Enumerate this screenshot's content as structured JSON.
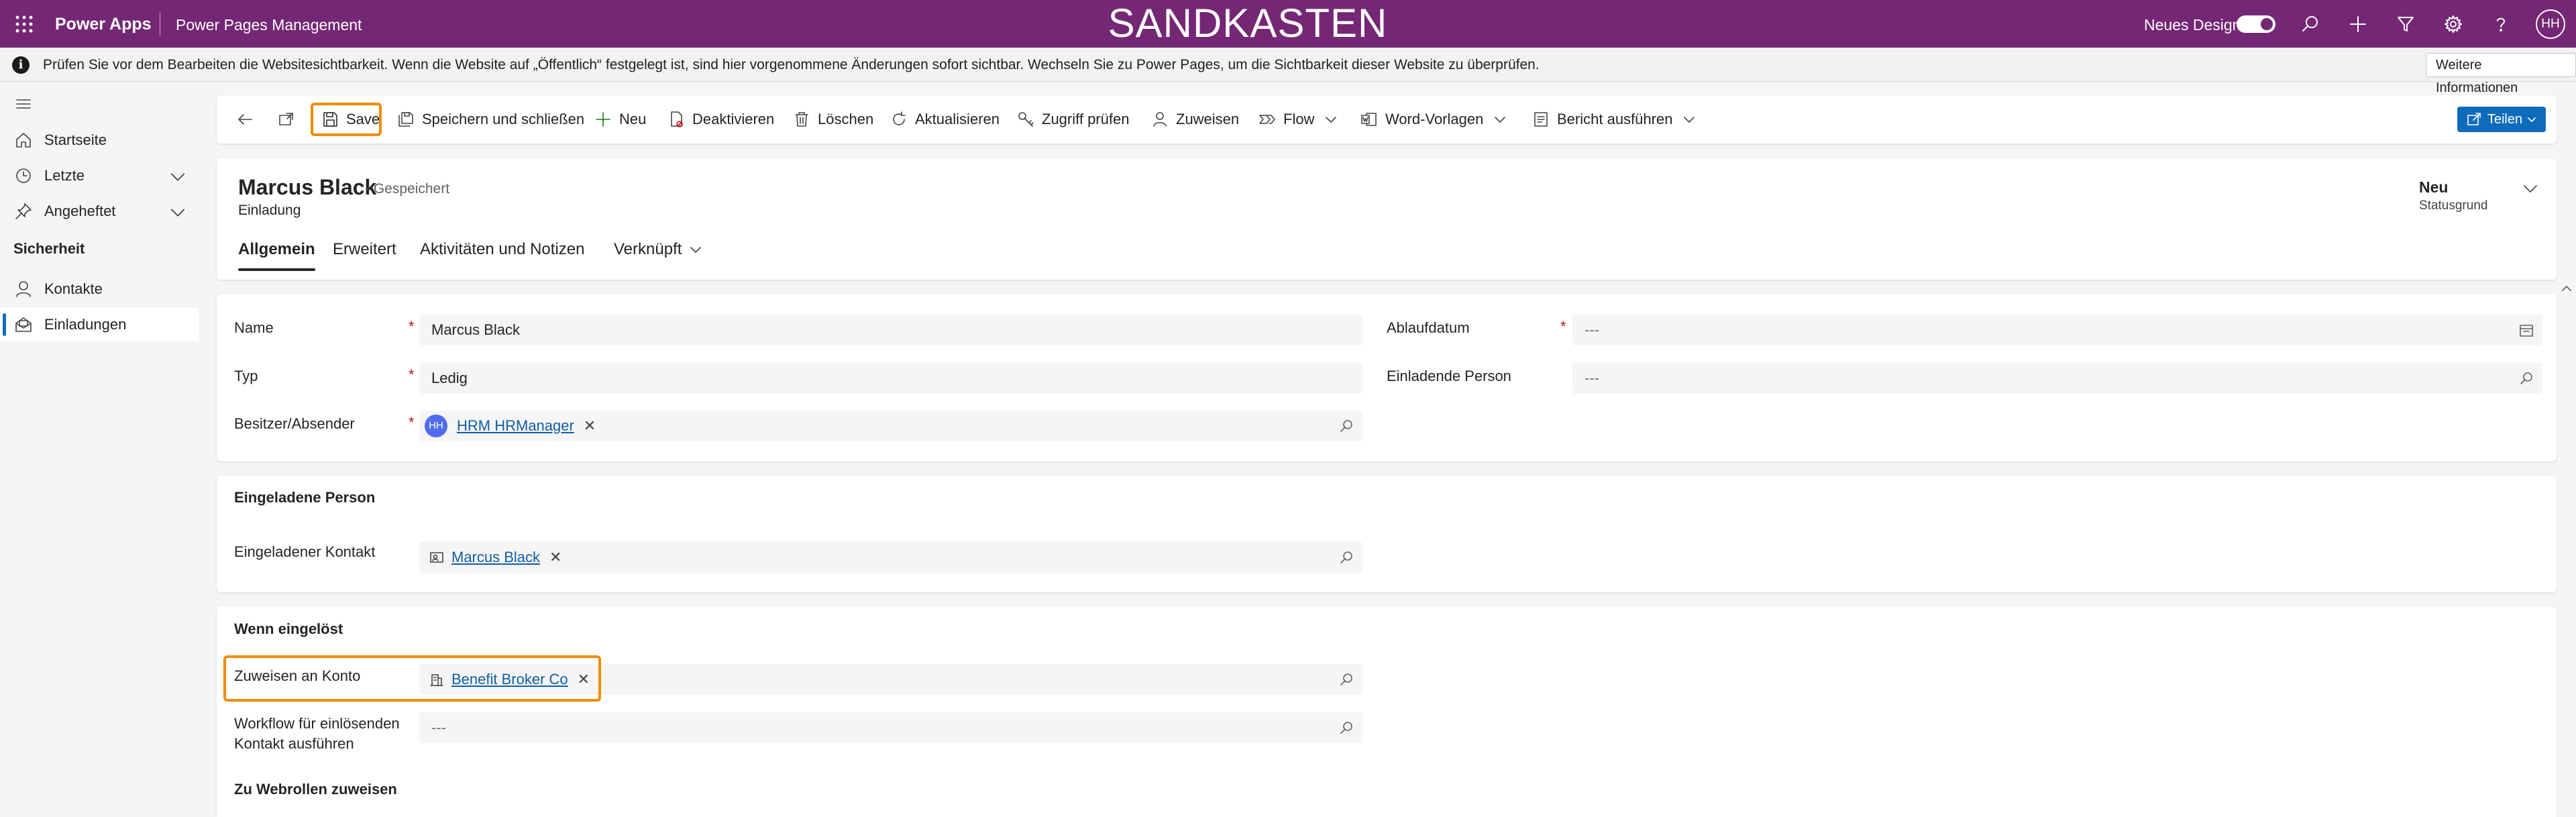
{
  "topbar": {
    "app_name": "Power Apps",
    "module_name": "Power Pages Management",
    "environment_banner": "SANDKASTEN",
    "new_design_label": "Neues Design",
    "avatar_initials": "HH",
    "background_color": "#742774"
  },
  "infobar": {
    "message": "Prüfen Sie vor dem Bearbeiten die Websitesichtbarkeit. Wenn die Website auf „Öffentlich“ festgelegt ist, sind hier vorgenommene Änderungen sofort sichtbar. Wechseln Sie zu Power Pages, um die Sichtbarkeit dieser Website zu überprüfen.",
    "more_button": "Weitere Informationen"
  },
  "sidebar": {
    "items": [
      {
        "label": "Startseite",
        "icon": "home-icon"
      },
      {
        "label": "Letzte",
        "icon": "clock-icon"
      },
      {
        "label": "Angeheftet",
        "icon": "pin-icon"
      }
    ],
    "section_title": "Sicherheit",
    "section_items": [
      {
        "label": "Kontakte",
        "icon": "person-icon"
      },
      {
        "label": "Einladungen",
        "icon": "mail-open-icon"
      }
    ]
  },
  "commandbar": {
    "save": "Save",
    "save_and_close": "Speichern und schließen",
    "new": "Neu",
    "deactivate": "Deaktivieren",
    "delete": "Löschen",
    "refresh": "Aktualisieren",
    "check_access": "Zugriff prüfen",
    "assign": "Zuweisen",
    "flow": "Flow",
    "word_templates": "Word-Vorlagen",
    "run_report": "Bericht ausführen",
    "share": "Teilen"
  },
  "record": {
    "title": "Marcus Black",
    "saved_status": "- Gespeichert",
    "entity": "Einladung",
    "status_value": "Neu",
    "status_label": "Statusgrund",
    "tabs": [
      "Allgemein",
      "Erweitert",
      "Aktivitäten und Notizen",
      "Verknüpft"
    ]
  },
  "general": {
    "name_label": "Name",
    "name_value": "Marcus Black",
    "type_label": "Typ",
    "type_value": "Ledig",
    "owner_label": "Besitzer/Absender",
    "owner_initials": "HH",
    "owner_value": "HRM HRManager",
    "expiry_label": "Ablaufdatum",
    "expiry_value": "---",
    "inviter_label": "Einladende Person",
    "inviter_value": "---"
  },
  "invited": {
    "section_title": "Eingeladene Person",
    "contact_label": "Eingeladener Kontakt",
    "contact_value": "Marcus Black"
  },
  "redeemed": {
    "section_title": "Wenn eingelöst",
    "account_label": "Zuweisen an Konto",
    "account_value": "Benefit Broker Co",
    "workflow_label_line1": "Workflow für einlösenden",
    "workflow_label_line2": "Kontakt ausführen",
    "workflow_value": "---",
    "webroles_title": "Zu Webrollen zuweisen"
  },
  "colors": {
    "accent": "#0f6cbd",
    "highlight": "#f28c00",
    "required": "#c50f1f"
  }
}
